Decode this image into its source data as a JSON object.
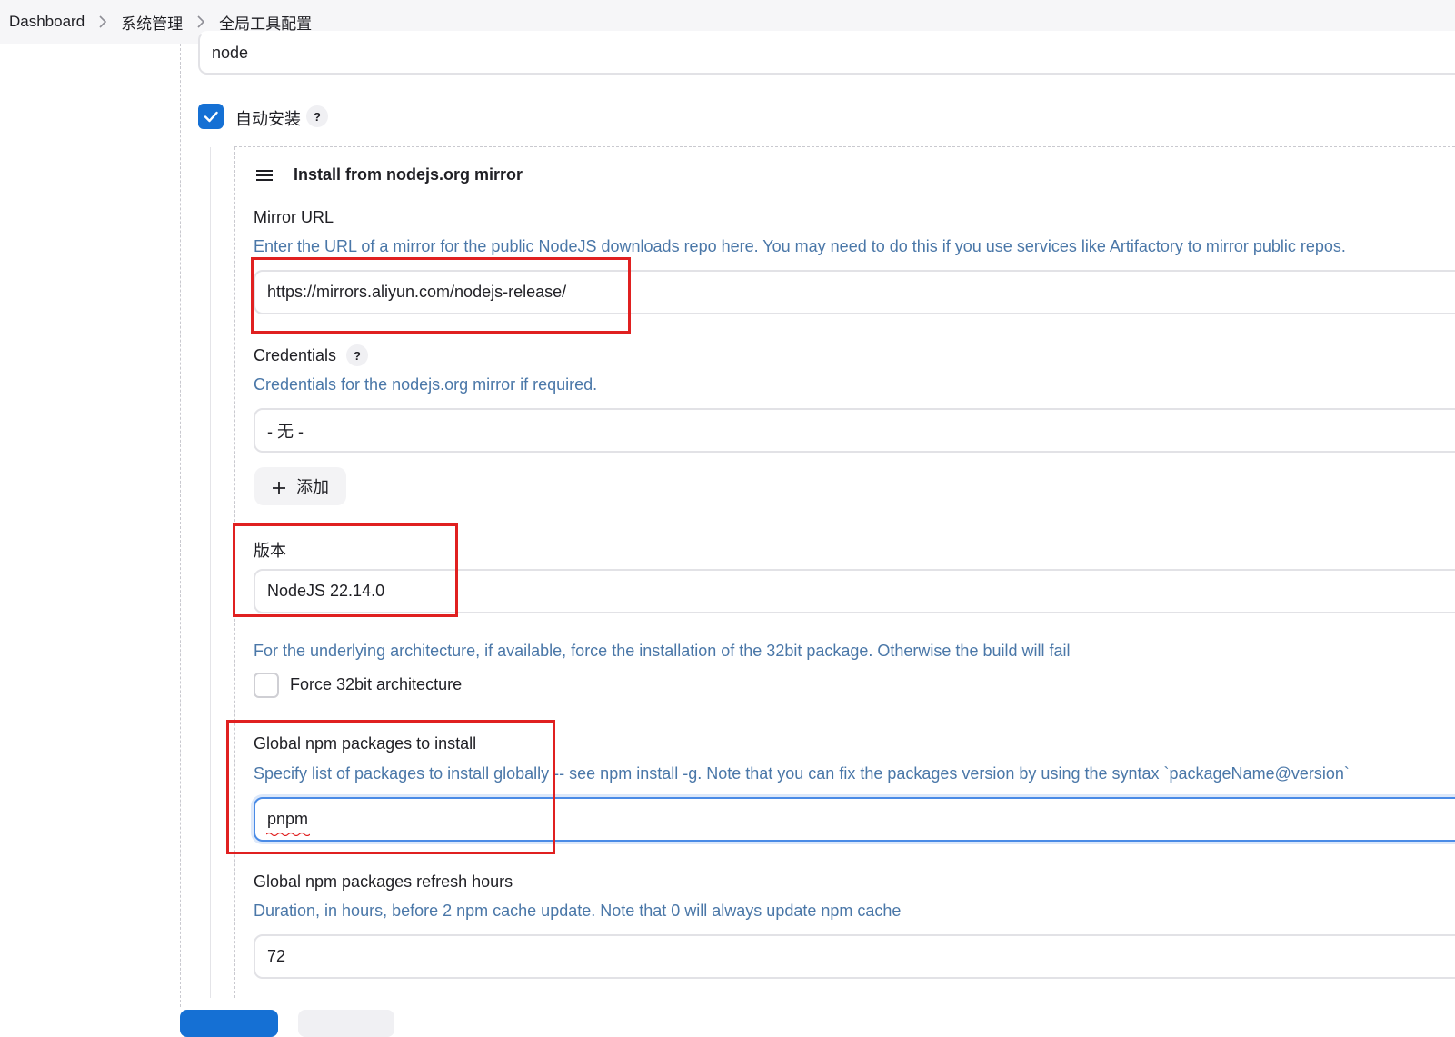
{
  "breadcrumb": {
    "items": [
      "Dashboard",
      "系统管理",
      "全局工具配置"
    ]
  },
  "name_field": {
    "value": "node"
  },
  "auto_install": {
    "label": "自动安装",
    "checked": true,
    "help": "?"
  },
  "installer": {
    "title": "Install from nodejs.org mirror",
    "mirror_url": {
      "label": "Mirror URL",
      "description": "Enter the URL of a mirror for the public NodeJS downloads repo here. You may need to do this if you use services like Artifactory to mirror public repos.",
      "value": "https://mirrors.aliyun.com/nodejs-release/"
    },
    "credentials": {
      "label": "Credentials",
      "help": "?",
      "description": "Credentials for the nodejs.org mirror if required.",
      "value": "- 无 -",
      "add_label": "添加"
    },
    "version": {
      "label": "版本",
      "value": "NodeJS 22.14.0"
    },
    "force32": {
      "description": "For the underlying architecture, if available, force the installation of the 32bit package. Otherwise the build will fail",
      "label": "Force 32bit architecture",
      "checked": false
    },
    "global_packages": {
      "label": "Global npm packages to install",
      "description": "Specify list of packages to install globally -- see npm install -g. Note that you can fix the packages version by using the syntax `packageName@version`",
      "value": "pnpm"
    },
    "refresh_hours": {
      "label": "Global npm packages refresh hours",
      "description": "Duration, in hours, before 2 npm cache update. Note that 0 will always update npm cache",
      "value": "72"
    }
  },
  "colors": {
    "accent": "#1570d4",
    "description_text": "#4a77a8",
    "highlight_box": "#e02020"
  }
}
